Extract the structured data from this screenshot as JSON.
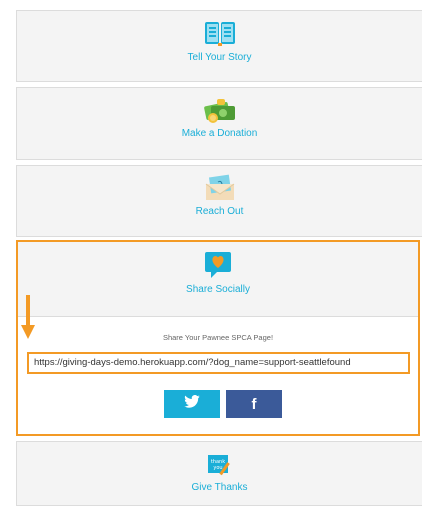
{
  "cards": {
    "story": {
      "label": "Tell Your Story",
      "icon": "open-book-icon"
    },
    "donate": {
      "label": "Make a Donation",
      "icon": "money-bag-icon"
    },
    "reach": {
      "label": "Reach Out",
      "icon": "envelope-icon"
    },
    "share": {
      "label": "Share Socially",
      "icon": "heart-speech-bubble-icon"
    },
    "thanks": {
      "label": "Give Thanks",
      "icon": "thank-you-card-icon"
    }
  },
  "share": {
    "caption": "Share Your Pawnee SPCA Page!",
    "url": "https://giving-days-demo.herokuapp.com/?dog_name=support-seattlefound",
    "facebook_glyph": "f"
  },
  "colors": {
    "accent_blue": "#1aaed7",
    "highlight_orange": "#f39a25",
    "facebook_blue": "#3b5a99"
  }
}
